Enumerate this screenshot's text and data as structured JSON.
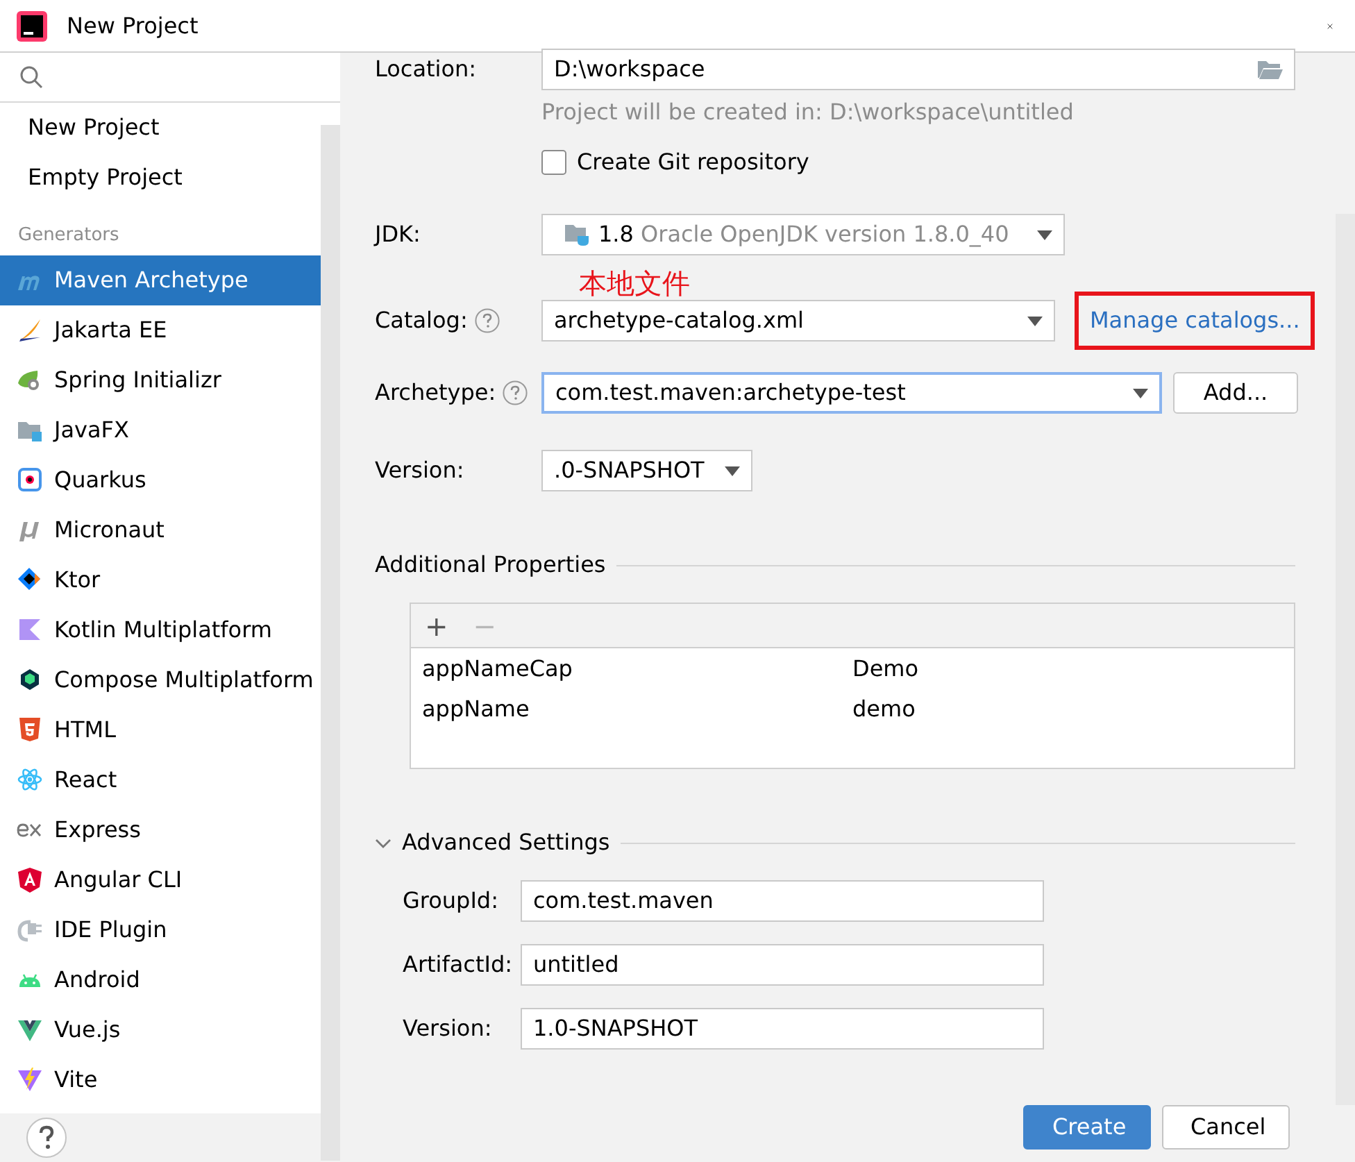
{
  "window": {
    "title": "New Project"
  },
  "sidebar": {
    "items": [
      {
        "label": "New Project",
        "selected": false
      },
      {
        "label": "Empty Project",
        "selected": false
      }
    ],
    "section": "Generators",
    "generators": [
      {
        "label": "Maven Archetype",
        "kind": "maven",
        "selected": true
      },
      {
        "label": "Jakarta EE",
        "kind": "jakarta",
        "selected": false
      },
      {
        "label": "Spring Initializr",
        "kind": "spring",
        "selected": false
      },
      {
        "label": "JavaFX",
        "kind": "javafx",
        "selected": false
      },
      {
        "label": "Quarkus",
        "kind": "quarkus",
        "selected": false
      },
      {
        "label": "Micronaut",
        "kind": "micronaut",
        "selected": false
      },
      {
        "label": "Ktor",
        "kind": "ktor",
        "selected": false
      },
      {
        "label": "Kotlin Multiplatform",
        "kind": "kotlin",
        "selected": false
      },
      {
        "label": "Compose Multiplatform",
        "kind": "compose",
        "selected": false
      },
      {
        "label": "HTML",
        "kind": "html",
        "selected": false
      },
      {
        "label": "React",
        "kind": "react",
        "selected": false
      },
      {
        "label": "Express",
        "kind": "express",
        "selected": false
      },
      {
        "label": "Angular CLI",
        "kind": "angular",
        "selected": false
      },
      {
        "label": "IDE Plugin",
        "kind": "plugin",
        "selected": false
      },
      {
        "label": "Android",
        "kind": "android",
        "selected": false
      },
      {
        "label": "Vue.js",
        "kind": "vue",
        "selected": false
      },
      {
        "label": "Vite",
        "kind": "vite",
        "selected": false
      }
    ]
  },
  "form": {
    "location": {
      "label": "Location:",
      "value": "D:\\workspace"
    },
    "hint": "Project will be created in: D:\\workspace\\untitled",
    "git": {
      "label": "Create Git repository",
      "checked": false
    },
    "jdk": {
      "label": "JDK:",
      "version": "1.8",
      "name": "Oracle OpenJDK version 1.8.0_40"
    },
    "annotation": "本地文件",
    "catalog": {
      "label": "Catalog:",
      "value": "archetype-catalog.xml",
      "link": "Manage catalogs..."
    },
    "archetype": {
      "label": "Archetype:",
      "value": "com.test.maven:archetype-test",
      "focused": true,
      "button": "Add..."
    },
    "version": {
      "label": "Version:",
      "value": ".0-SNAPSHOT"
    },
    "properties": {
      "title": "Additional Properties",
      "add": "+",
      "remove": "−",
      "rows": [
        {
          "key": "appNameCap",
          "value": "Demo"
        },
        {
          "key": "appName",
          "value": "demo"
        }
      ]
    },
    "advanced": {
      "title": "Advanced Settings",
      "expanded": true,
      "fields": [
        {
          "label": "GroupId:",
          "value": "com.test.maven"
        },
        {
          "label": "ArtifactId:",
          "value": "untitled"
        },
        {
          "label": "Version:",
          "value": "1.0-SNAPSHOT"
        }
      ]
    }
  },
  "buttons": [
    {
      "label": "Create",
      "primary": true
    },
    {
      "label": "Cancel",
      "primary": false
    }
  ]
}
